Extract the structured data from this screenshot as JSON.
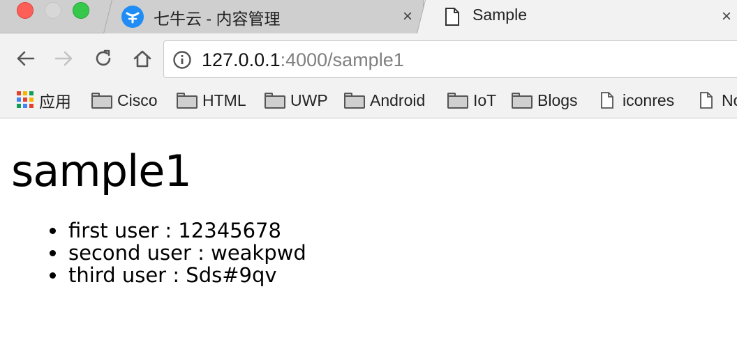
{
  "browser": {
    "tabs": [
      {
        "title": "七牛云 - 内容管理",
        "favicon": "qiniu-logo-icon",
        "close": "×"
      },
      {
        "title": "Sample",
        "favicon": "document-icon",
        "close": "×"
      }
    ],
    "address": {
      "host": "127.0.0.1",
      "rest": ":4000/sample1"
    },
    "bookmarks": [
      {
        "label": "应用",
        "icon": "apps-grid-icon"
      },
      {
        "label": "Cisco",
        "icon": "folder-icon"
      },
      {
        "label": "HTML",
        "icon": "folder-icon"
      },
      {
        "label": "UWP",
        "icon": "folder-icon"
      },
      {
        "label": "Android",
        "icon": "folder-icon"
      },
      {
        "label": "IoT",
        "icon": "folder-icon"
      },
      {
        "label": "Blogs",
        "icon": "folder-icon"
      },
      {
        "label": "iconres",
        "icon": "document-icon"
      },
      {
        "label": "No",
        "icon": "document-icon"
      }
    ]
  },
  "page": {
    "heading": "sample1",
    "users": [
      "first user : 12345678",
      "second user : weakpwd",
      "third user : Sds#9qv"
    ]
  },
  "colors": {
    "close_red": "#fc5f57",
    "minimize_gray": "#d7d7d7",
    "zoom_green": "#35c84a",
    "qiniu_blue": "#1f8df5",
    "tabstrip": "#cfcfcf",
    "toolbar": "#f2f2f2"
  }
}
